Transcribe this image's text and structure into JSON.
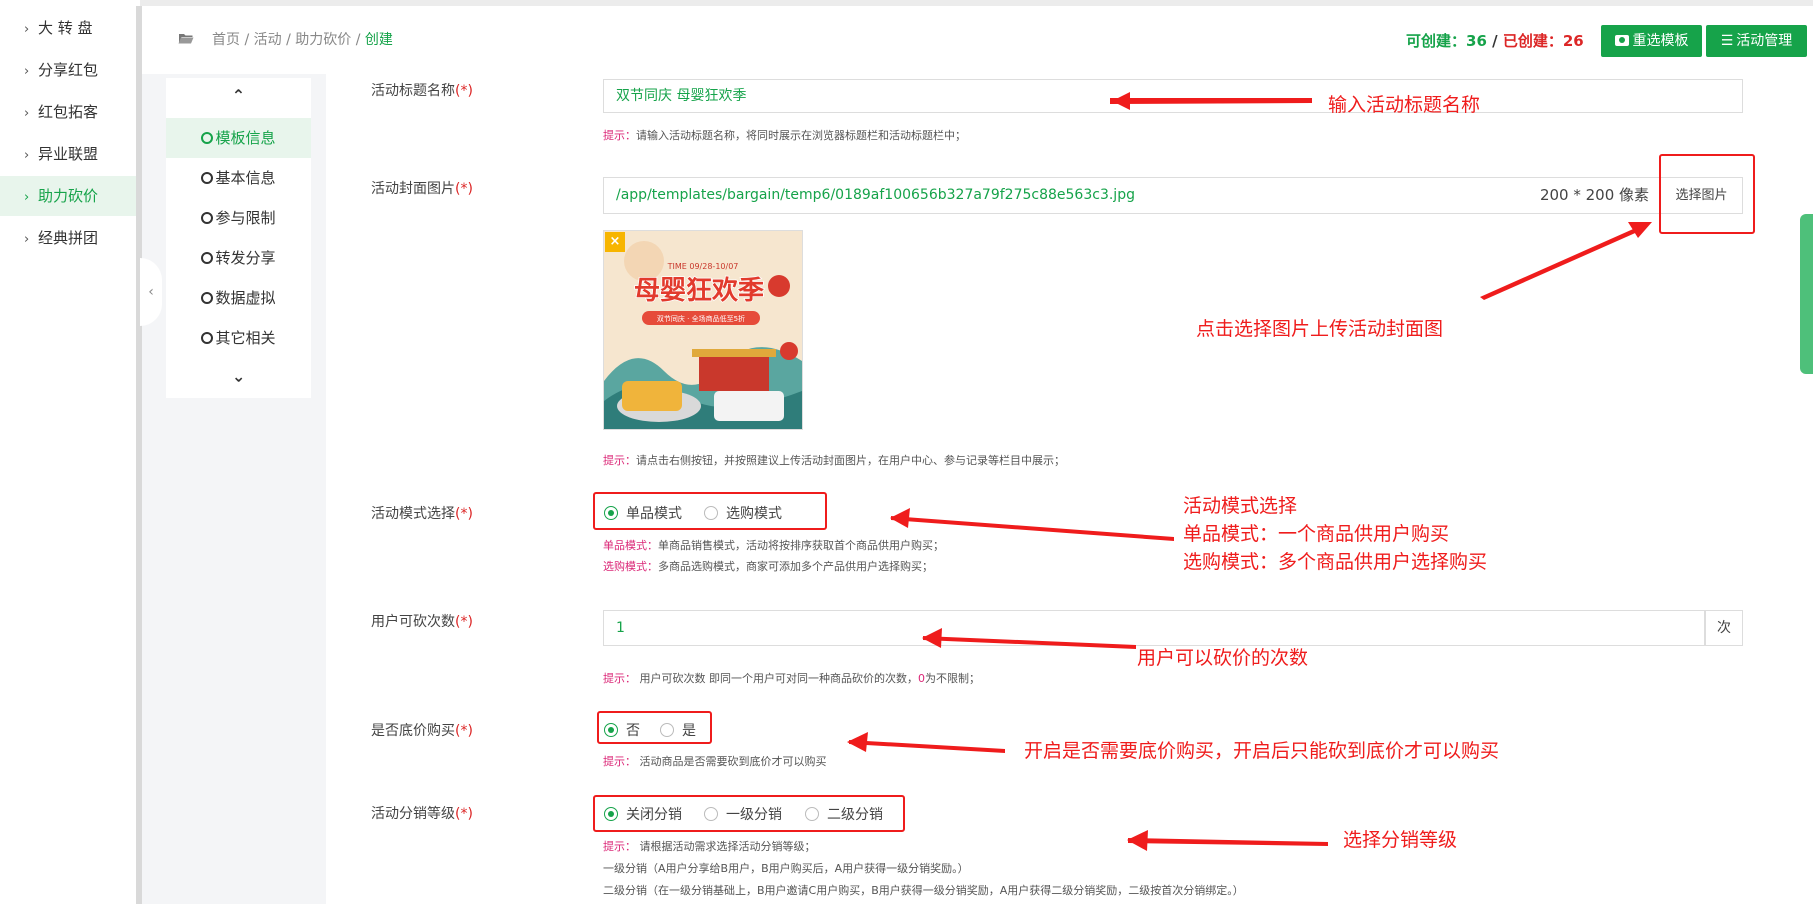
{
  "nav": {
    "items": [
      {
        "label": "大 转 盘",
        "active": false
      },
      {
        "label": "分享红包",
        "active": false
      },
      {
        "label": "红包拓客",
        "active": false
      },
      {
        "label": "异业联盟",
        "active": false
      },
      {
        "label": "助力砍价",
        "active": true
      },
      {
        "label": "经典拼团",
        "active": false
      }
    ]
  },
  "header": {
    "breadcrumb": {
      "home": "首页",
      "sep": "/",
      "activity": "活动",
      "bargain": "助力砍价",
      "current": "创建"
    },
    "quota": {
      "can_create_label": "可创建：",
      "can_create_value": "36",
      "slash": "/",
      "created_label": "已创建：",
      "created_value": "26"
    },
    "buttons": {
      "reselect_template": "重选模板",
      "activity_manage": "活动管理"
    }
  },
  "sections": {
    "items": [
      {
        "label": "模板信息",
        "active": true
      },
      {
        "label": "基本信息",
        "active": false
      },
      {
        "label": "参与限制",
        "active": false
      },
      {
        "label": "转发分享",
        "active": false
      },
      {
        "label": "数据虚拟",
        "active": false
      },
      {
        "label": "其它相关",
        "active": false
      }
    ]
  },
  "form": {
    "required_mark": "(*)",
    "title": {
      "label": "活动标题名称",
      "value": "双节同庆 母婴狂欢季",
      "hint_key": "提示：",
      "hint": "请输入活动标题名称，将同时展示在浏览器标题栏和活动标题栏中；"
    },
    "cover": {
      "label": "活动封面图片",
      "value": "/app/templates/bargain/temp6/0189af100656b327a79f275c88e563c3.jpg",
      "size": "200 * 200 像素",
      "select_btn": "选择图片",
      "hint_key": "提示：",
      "hint": "请点击右侧按钮，并按照建议上传活动封面图片，在用户中心、参与记录等栏目中展示；",
      "image_text": {
        "date": "TIME 09/28-10/07",
        "headline": "母婴狂欢季",
        "sub": "双节同庆 · 全场商品低至5折"
      }
    },
    "mode": {
      "label": "活动模式选择",
      "options": [
        "单品模式",
        "选购模式"
      ],
      "selected": "单品模式",
      "hint1_key": "单品模式：",
      "hint1": "单商品销售模式，活动将按排序获取首个商品供用户购买；",
      "hint2_key": "选购模式：",
      "hint2": "多商品选购模式，商家可添加多个产品供用户选择购买；"
    },
    "times": {
      "label": "用户可砍次数",
      "value": "1",
      "unit": "次",
      "hint_key": "提示：",
      "hint_a": " 用户可砍次数 即同一个用户可对同一种商品砍价的次数，",
      "hint_zero": "0",
      "hint_b": "为不限制；"
    },
    "floor": {
      "label": "是否底价购买",
      "options": [
        "否",
        "是"
      ],
      "selected": "否",
      "hint_key": "提示：",
      "hint": " 活动商品是否需要砍到底价才可以购买"
    },
    "distribution": {
      "label": "活动分销等级",
      "options": [
        "关闭分销",
        "一级分销",
        "二级分销"
      ],
      "selected": "关闭分销",
      "hint_key": "提示：",
      "hint": " 请根据活动需求选择活动分销等级；",
      "hint_level1": "一级分销（A用户分享给B用户，B用户购买后，A用户获得一级分销奖励。）",
      "hint_level2": "二级分销（在一级分销基础上，B用户邀请C用户购买，B用户获得一级分销奖励，A用户获得二级分销奖励，二级按首次分销绑定。）"
    }
  },
  "annotations": {
    "title": "输入活动标题名称",
    "cover": "点击选择图片上传活动封面图",
    "mode_1": "活动模式选择",
    "mode_2": "单品模式：一个商品供用户购买",
    "mode_3": "选购模式：多个商品供用户选择购买",
    "times": "用户可以砍价的次数",
    "floor": "开启是否需要底价购买，开启后只能砍到底价才可以购买",
    "distribution": "选择分销等级"
  },
  "colors": {
    "accent": "#16a34a",
    "annotation": "#ef1c1c",
    "required": "#dc2626",
    "hint_key": "#db2777"
  }
}
